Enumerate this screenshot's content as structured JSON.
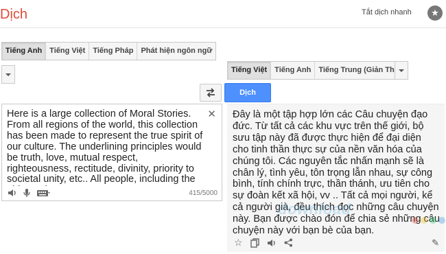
{
  "app": {
    "title": "Dịch",
    "instant_label": "Tắt dịch nhanh"
  },
  "source": {
    "tabs": [
      "Tiếng Anh",
      "Tiếng Việt",
      "Tiếng Pháp",
      "Phát hiện ngôn ngữ"
    ],
    "active_tab": 0,
    "text": "Here is a large collection of Moral Stories. From all regions of the world, this collection has been made to represent the true spirit of our culture. The underlining principles would be truth, love, mutual respect, righteousness, rectitude, divinity, priority to societal unity, etc.. All people, including the old people,",
    "char_count": "415/5000"
  },
  "target": {
    "tabs": [
      "Tiếng Việt",
      "Tiếng Anh",
      "Tiếng Trung (Giản Thể)"
    ],
    "active_tab": 0,
    "text": "Đây là một tập hợp lớn các Câu chuyện đạo đức. Từ tất cả các khu vực trên thế giới, bộ sưu tập này đã được thực hiện để đại diện cho tinh thần thực sự của nền văn hóa của chúng tôi. Các nguyên tắc nhấn mạnh sẽ là chân lý, tình yêu, tôn trọng lẫn nhau, sự công bình, tính chính trực, thần thánh, ưu tiên cho sự đoàn kết xã hội, vv .. Tất cả mọi người, kể cả người già, đều thích đọc những câu chuyện này. Bạn được chào đón để chia sẻ những câu chuyện này với bạn bè của bạn."
  },
  "actions": {
    "translate_label": "Dịch"
  },
  "watermark": {
    "text": "download",
    "colors": [
      "#e74c3c",
      "#f1c40f",
      "#2ecc71",
      "#3498db"
    ]
  },
  "colors": {
    "brand": "#dd4b39",
    "primary_button": "#4d90fe"
  },
  "icons": [
    "star-icon",
    "swap-icon",
    "clear-icon",
    "speaker-icon",
    "microphone-icon",
    "keyboard-icon",
    "copy-icon",
    "share-icon",
    "pencil-icon"
  ]
}
